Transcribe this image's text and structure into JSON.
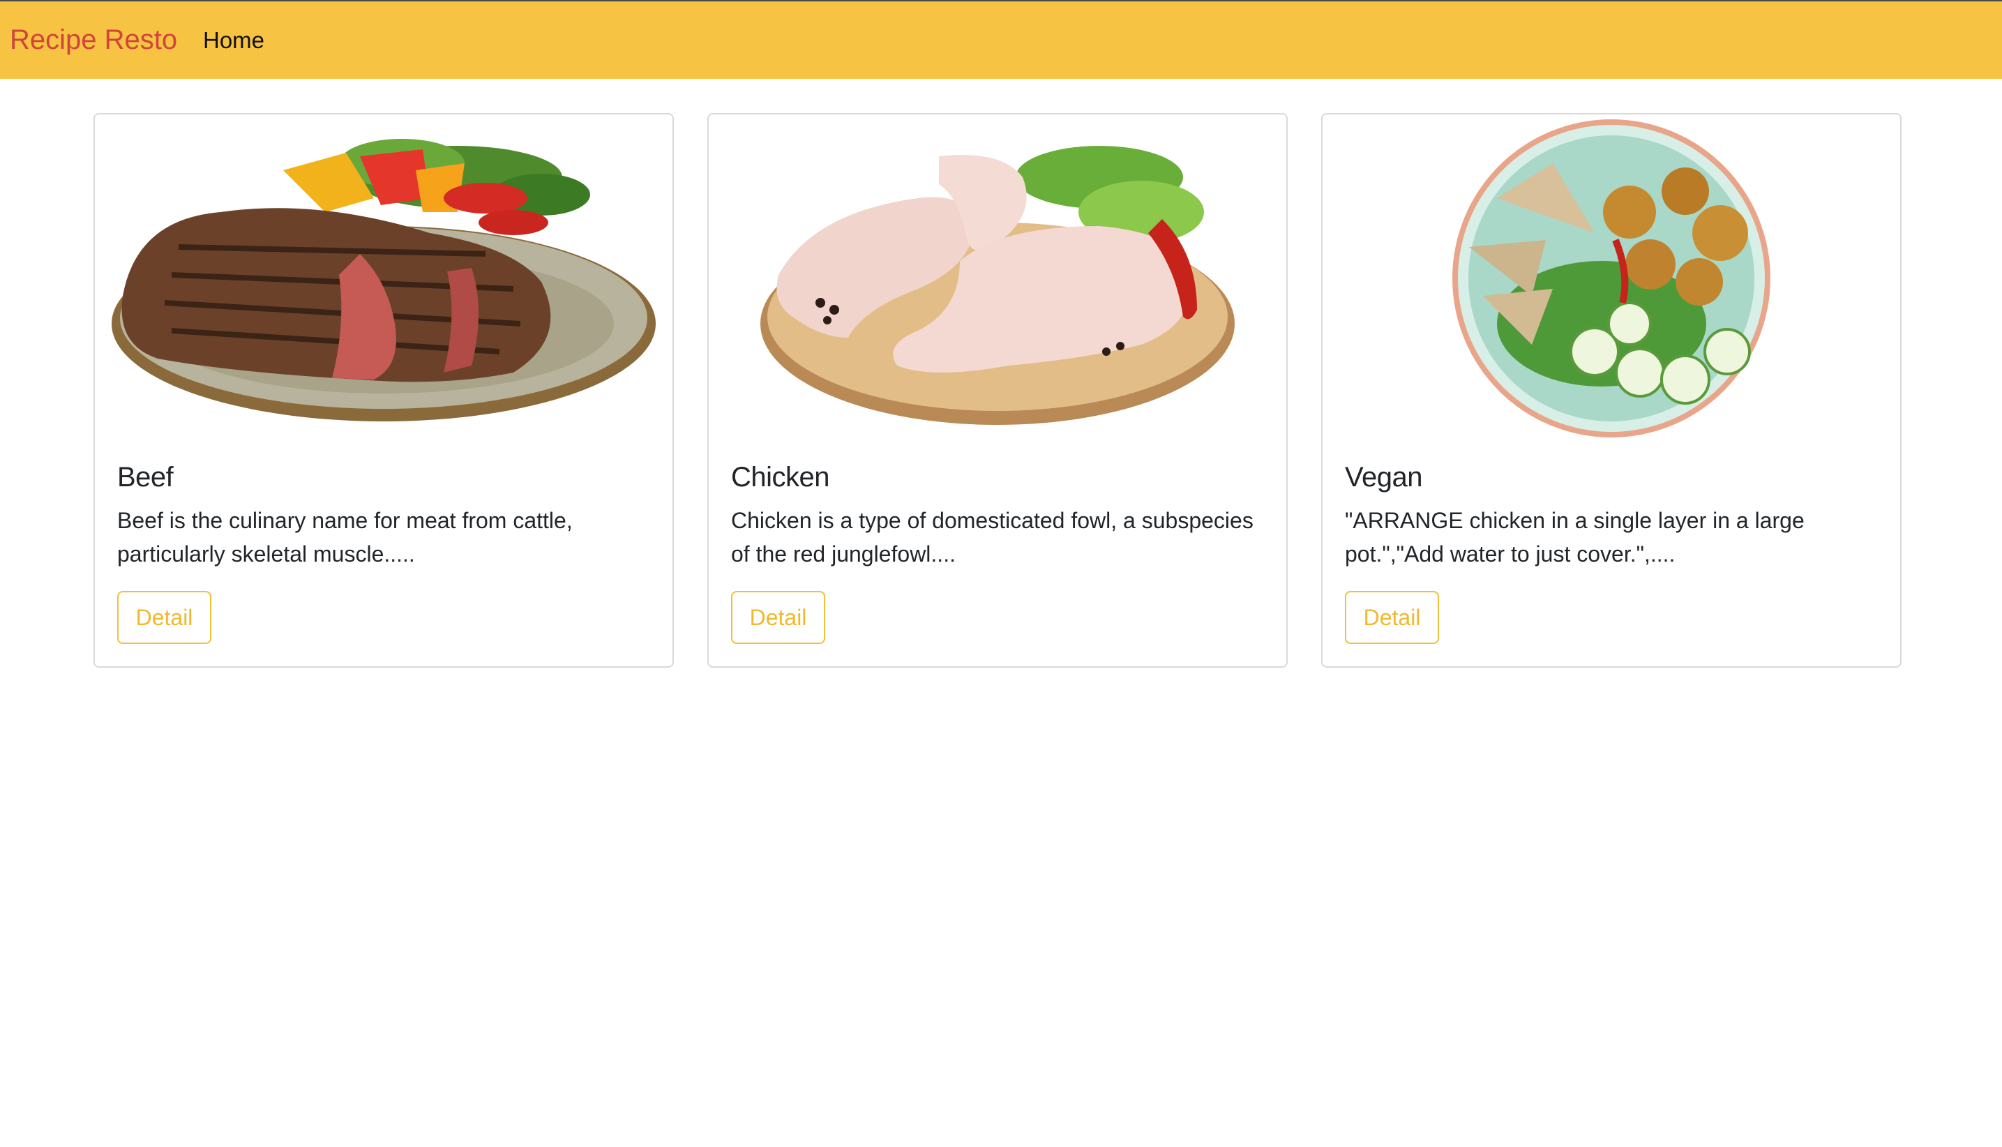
{
  "navbar": {
    "brand": "Recipe Resto",
    "links": [
      {
        "label": "Home"
      }
    ]
  },
  "categories": [
    {
      "title": "Beef",
      "image": "beef-steak-photo",
      "description": "Beef is the culinary name for meat from cattle, particularly skeletal muscle.....",
      "button_label": "Detail"
    },
    {
      "title": "Chicken",
      "image": "raw-chicken-legs-photo",
      "description": "Chicken is a type of domesticated fowl, a subspecies of the red junglefowl....",
      "button_label": "Detail"
    },
    {
      "title": "Vegan",
      "image": "vegan-bowl-photo",
      "description": "\"ARRANGE chicken in a single layer in a large pot.\",\"Add water to just cover.\",....",
      "button_label": "Detail"
    }
  ],
  "colors": {
    "navbar_bg": "#f6c343",
    "brand_text": "#d2443a",
    "button_outline": "#f0c03c"
  }
}
